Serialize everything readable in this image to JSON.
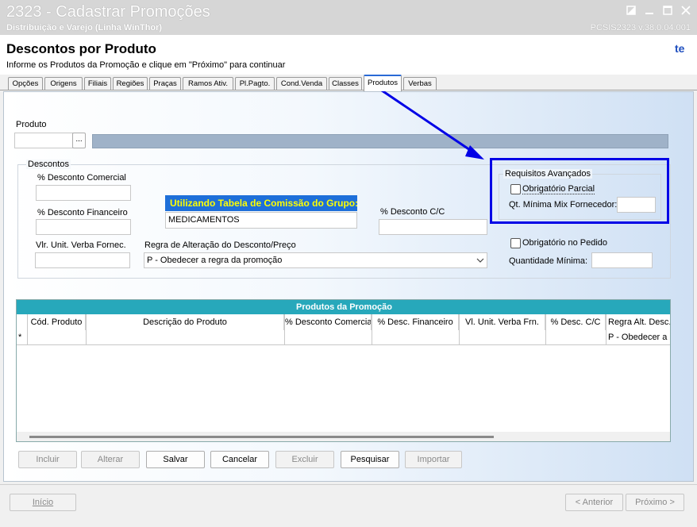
{
  "window": {
    "title": "2323 - Cadastrar Promoções",
    "subtitle": "Distribuição e Varejo (Linha WinThor)",
    "version": "PCSIS2323  v.38.0.04.001"
  },
  "header": {
    "title": "Descontos por Produto",
    "instructions": "Informe os Produtos da Promoção e clique em \"Próximo\" para continuar",
    "badge": "te"
  },
  "tabs": [
    {
      "label": "Opções"
    },
    {
      "label": "Origens"
    },
    {
      "label": "Filiais"
    },
    {
      "label": "Regiões"
    },
    {
      "label": "Praças"
    },
    {
      "label": "Ramos Ativ."
    },
    {
      "label": "Pl.Pagto."
    },
    {
      "label": "Cond.Venda"
    },
    {
      "label": "Classes"
    },
    {
      "label": "Produtos"
    },
    {
      "label": "Verbas"
    }
  ],
  "produto": {
    "label": "Produto",
    "value": "",
    "lookup_label": "..."
  },
  "descontos": {
    "caption": "Descontos",
    "comercial_label": "% Desconto Comercial",
    "financeiro_label": "% Desconto Financeiro",
    "verba_label": "Vlr. Unit. Verba Fornec.",
    "cc_label": "% Desconto C/C",
    "comissao_title": "Utilizando Tabela de Comissão do Grupo:",
    "comissao_value": "MEDICAMENTOS",
    "regra_label": "Regra de Alteração do Desconto/Preço",
    "regra_selected": "P - Obedecer a regra da promoção"
  },
  "requisitos": {
    "caption": "Requisitos Avançados",
    "obrigatorio_parcial": "Obrigatório Parcial",
    "qt_minima_mix_label": "Qt. Mínima Mix Fornecedor:",
    "obrigatorio_pedido": "Obrigatório no Pedido",
    "quantidade_minima_label": "Quantidade Mínima:"
  },
  "grid": {
    "title": "Produtos da Promoção",
    "columns": [
      "Cód. Produto",
      "Descrição do Produto",
      "% Desconto Comercia",
      "% Desc. Financeiro",
      "Vl. Unit. Verba Frn.",
      "% Desc. C/C",
      "Regra Alt. Desc."
    ],
    "new_row_marker": "*",
    "new_row_regra": "P - Obedecer a r"
  },
  "actions": {
    "incluir": "Incluir",
    "alterar": "Alterar",
    "salvar": "Salvar",
    "cancelar": "Cancelar",
    "excluir": "Excluir",
    "pesquisar": "Pesquisar",
    "importar": "Importar"
  },
  "footer": {
    "inicio": "Início",
    "anterior": "< Anterior",
    "proximo": "Próximo >"
  },
  "colors": {
    "accent_tab": "#2a6ad6",
    "comissao_bg": "#1e6fd9",
    "comissao_text": "#ffff00",
    "grid_header": "#27a8bb",
    "annotation": "#0000e6"
  }
}
